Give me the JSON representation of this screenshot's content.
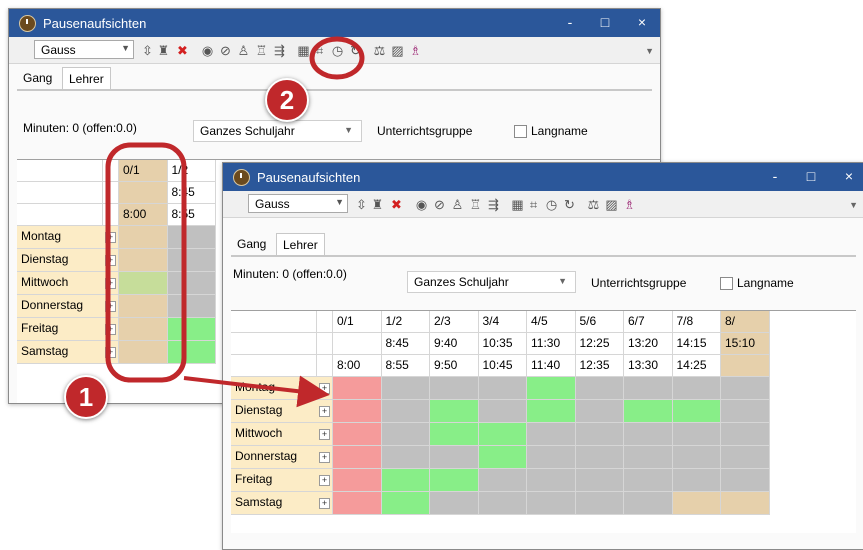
{
  "window": {
    "title": "Pausenaufsichten",
    "controls": {
      "minimize": "-",
      "maximize": "□",
      "close": "×"
    }
  },
  "toolbar": {
    "teacher_value": "Gauss",
    "icons": [
      "arrange-icon",
      "hat-icon",
      "delete-icon",
      "eye-icon",
      "eye-crossed-icon",
      "persons-icon",
      "person-tool-icon",
      "assign-icon",
      "calculator-icon",
      "crop-icon",
      "clock-icon",
      "refresh-icon",
      "scales-icon",
      "chart-icon",
      "people-icon"
    ]
  },
  "tabs": [
    {
      "label": "Gang"
    },
    {
      "label": "Lehrer"
    }
  ],
  "info": {
    "minuten": "Minuten: 0 (offen:0.0)",
    "period_value": "Ganzes Schuljahr",
    "unterrichtsgruppe": "Unterrichtsgruppe",
    "langname": "Langname"
  },
  "grid": {
    "columns": [
      {
        "label": "0/1",
        "start": "",
        "end": "8:00"
      },
      {
        "label": "1/2",
        "start": "8:45",
        "end": "8:55"
      },
      {
        "label": "2/3",
        "start": "9:40",
        "end": "9:50"
      },
      {
        "label": "3/4",
        "start": "10:35",
        "end": "10:45"
      },
      {
        "label": "4/5",
        "start": "11:30",
        "end": "11:40"
      },
      {
        "label": "5/6",
        "start": "12:25",
        "end": "12:35"
      },
      {
        "label": "6/7",
        "start": "13:20",
        "end": "13:30"
      },
      {
        "label": "7/8",
        "start": "14:15",
        "end": "14:25"
      },
      {
        "label": "8/",
        "start": "15:10",
        "end": ""
      }
    ],
    "days": [
      "Montag",
      "Dienstag",
      "Mittwoch",
      "Donnerstag",
      "Freitag",
      "Samstag"
    ],
    "front_states": [
      [
        "red",
        "grey",
        "grey",
        "grey",
        "green",
        "grey",
        "grey",
        "grey",
        "grey"
      ],
      [
        "red",
        "grey",
        "green",
        "grey",
        "green",
        "grey",
        "green",
        "green",
        "grey"
      ],
      [
        "red",
        "grey",
        "green",
        "green",
        "grey",
        "grey",
        "grey",
        "grey",
        "grey"
      ],
      [
        "red",
        "grey",
        "grey",
        "green",
        "grey",
        "grey",
        "grey",
        "grey",
        "grey"
      ],
      [
        "red",
        "green",
        "green",
        "grey",
        "grey",
        "grey",
        "grey",
        "grey",
        "grey"
      ],
      [
        "red",
        "green",
        "grey",
        "grey",
        "grey",
        "grey",
        "grey",
        "tan",
        "tan"
      ]
    ],
    "back_states": [
      [
        "tan",
        "grey"
      ],
      [
        "tan",
        "grey"
      ],
      [
        "lightgreen",
        "grey"
      ],
      [
        "tan",
        "grey"
      ],
      [
        "tan",
        "green"
      ],
      [
        "tan",
        "green"
      ]
    ]
  },
  "annotations": {
    "badge_1": "1",
    "badge_2": "2"
  },
  "colors": {
    "title_bar": "#2b579a",
    "row_header": "#fcecc6",
    "red": "#f59b9b",
    "green": "#88ee88",
    "grey": "#c0c0c0",
    "tan": "#e6d0ab",
    "lightgreen": "#c6dd9a",
    "annotation_red": "#c0282b"
  }
}
